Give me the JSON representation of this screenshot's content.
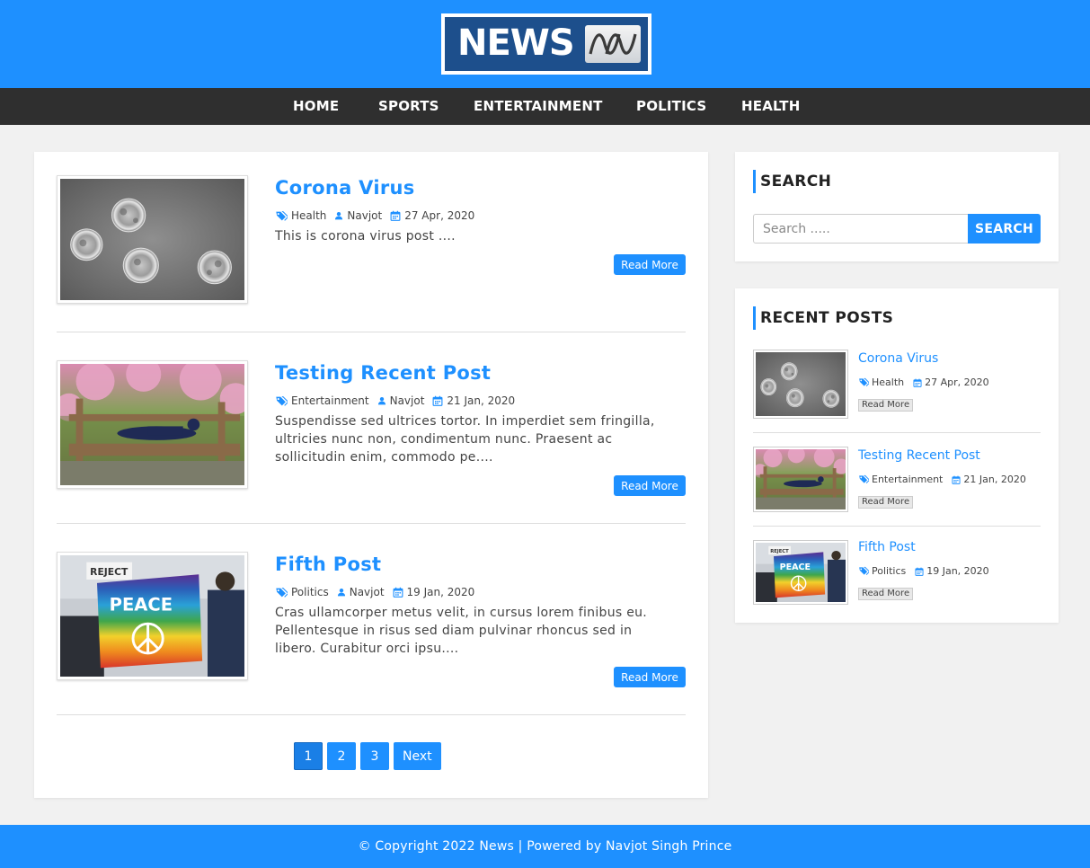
{
  "header": {
    "logo_text": "NEWS",
    "brand_color": "#1e90ff"
  },
  "nav": {
    "items": [
      {
        "label": "HOME"
      },
      {
        "label": "SPORTS"
      },
      {
        "label": "ENTERTAINMENT"
      },
      {
        "label": "POLITICS"
      },
      {
        "label": "HEALTH"
      }
    ]
  },
  "posts": [
    {
      "title": "Corona Virus",
      "category": "Health",
      "author": "Navjot",
      "date": "27 Apr, 2020",
      "excerpt": "This is corona virus post ....",
      "read_more": "Read More",
      "image": "virus-micrograph"
    },
    {
      "title": "Testing Recent Post",
      "category": "Entertainment",
      "author": "Navjot",
      "date": "21 Jan, 2020",
      "excerpt": "Suspendisse sed ultrices tortor. In imperdiet sem fringilla, ultricies nunc non, condimentum nunc. Praesent ac sollicitudin enim, commodo pe....",
      "read_more": "Read More",
      "image": "yoga-bench-park"
    },
    {
      "title": "Fifth Post",
      "category": "Politics",
      "author": "Navjot",
      "date": "19 Jan, 2020",
      "excerpt": "Cras ullamcorper metus velit, in cursus lorem finibus eu. Pellentesque in risus sed diam pulvinar rhoncus sed in libero. Curabitur orci ipsu....",
      "read_more": "Read More",
      "image": "peace-flag-protest"
    }
  ],
  "pagination": {
    "pages": [
      "1",
      "2",
      "3"
    ],
    "current": "1",
    "next_label": "Next"
  },
  "sidebar": {
    "search": {
      "title": "SEARCH",
      "placeholder": "Search .....",
      "button_label": "SEARCH"
    },
    "recent": {
      "title": "RECENT POSTS",
      "items": [
        {
          "title": "Corona Virus",
          "category": "Health",
          "date": "27 Apr, 2020",
          "read_more": "Read More"
        },
        {
          "title": "Testing Recent Post",
          "category": "Entertainment",
          "date": "21 Jan, 2020",
          "read_more": "Read More"
        },
        {
          "title": "Fifth Post",
          "category": "Politics",
          "date": "19 Jan, 2020",
          "read_more": "Read More"
        }
      ]
    }
  },
  "footer": {
    "text": "© Copyright 2022 News | Powered by Navjot Singh Prince"
  }
}
